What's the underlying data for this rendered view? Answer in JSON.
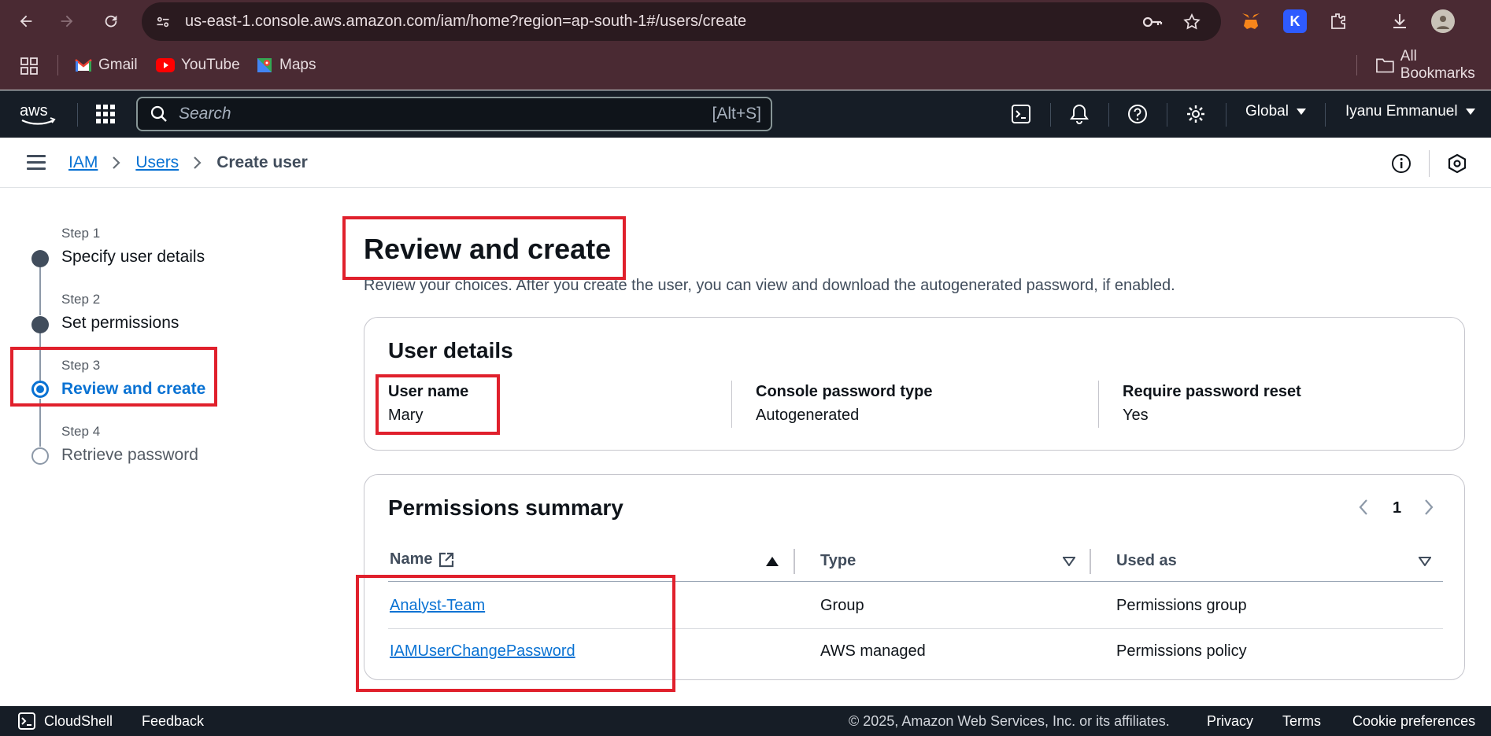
{
  "browser": {
    "url": "us-east-1.console.aws.amazon.com/iam/home?region=ap-south-1#/users/create",
    "bookmarks": [
      "Gmail",
      "YouTube",
      "Maps"
    ],
    "all_bookmarks": "All Bookmarks",
    "extension_badge": "K"
  },
  "aws_header": {
    "logo": "aws",
    "search_placeholder": "Search",
    "search_shortcut": "[Alt+S]",
    "region": "Global",
    "user": "Iyanu Emmanuel"
  },
  "breadcrumb": [
    "IAM",
    "Users",
    "Create user"
  ],
  "steps": [
    {
      "label": "Step 1",
      "title": "Specify user details",
      "state": "done"
    },
    {
      "label": "Step 2",
      "title": "Set permissions",
      "state": "done"
    },
    {
      "label": "Step 3",
      "title": "Review and create",
      "state": "current"
    },
    {
      "label": "Step 4",
      "title": "Retrieve password",
      "state": "pending"
    }
  ],
  "main": {
    "title": "Review and create",
    "description": "Review your choices. After you create the user, you can view and download the autogenerated password, if enabled."
  },
  "user_details": {
    "title": "User details",
    "fields": [
      {
        "key": "User name",
        "value": "Mary"
      },
      {
        "key": "Console password type",
        "value": "Autogenerated"
      },
      {
        "key": "Require password reset",
        "value": "Yes"
      }
    ]
  },
  "permissions": {
    "title": "Permissions summary",
    "page": "1",
    "columns": [
      "Name",
      "Type",
      "Used as"
    ],
    "rows": [
      {
        "name": "Analyst-Team",
        "type": "Group",
        "used_as": "Permissions group"
      },
      {
        "name": "IAMUserChangePassword",
        "type": "AWS managed",
        "used_as": "Permissions policy"
      }
    ]
  },
  "footer": {
    "cloudshell": "CloudShell",
    "feedback": "Feedback",
    "copyright": "© 2025, Amazon Web Services, Inc. or its affiliates.",
    "links": [
      "Privacy",
      "Terms",
      "Cookie preferences"
    ]
  },
  "colors": {
    "chrome": "#4a2a33",
    "aws_header": "#161d26",
    "link": "#0972d3",
    "highlight": "#e0202c"
  }
}
